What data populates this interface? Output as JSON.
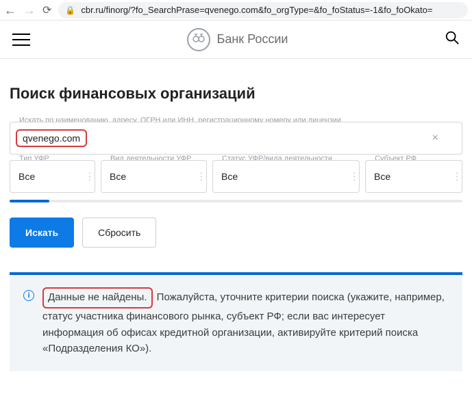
{
  "browser": {
    "url": "cbr.ru/finorg/?fo_SearchPrase=qvenego.com&fo_orgType=&fo_foStatus=-1&fo_foOkato="
  },
  "header": {
    "brand": "Банк России"
  },
  "page": {
    "title": "Поиск финансовых организаций"
  },
  "search": {
    "label": "Искать по наименованию, адресу, ОГРН или ИНН, регистрационному номеру или лицензии",
    "value": "qvenego.com"
  },
  "filters": {
    "type": {
      "label": "Тип УФР",
      "value": "Все"
    },
    "activity": {
      "label": "Вид деятельности УФР",
      "value": "Все"
    },
    "status": {
      "label": "Статус УФР/вида деятельности",
      "value": "Все"
    },
    "region": {
      "label": "Субъект РФ",
      "value": "Все"
    }
  },
  "buttons": {
    "search": "Искать",
    "reset": "Сбросить"
  },
  "result": {
    "not_found": "Данные не найдены.",
    "rest": " Пожалуйста, уточните критерии поиска (укажите, например, статус участника финансового рынка, субъект РФ; если вас интересует информация об офисах кредитной организации, активируйте критерий поиска «Подразделения КО»)."
  }
}
